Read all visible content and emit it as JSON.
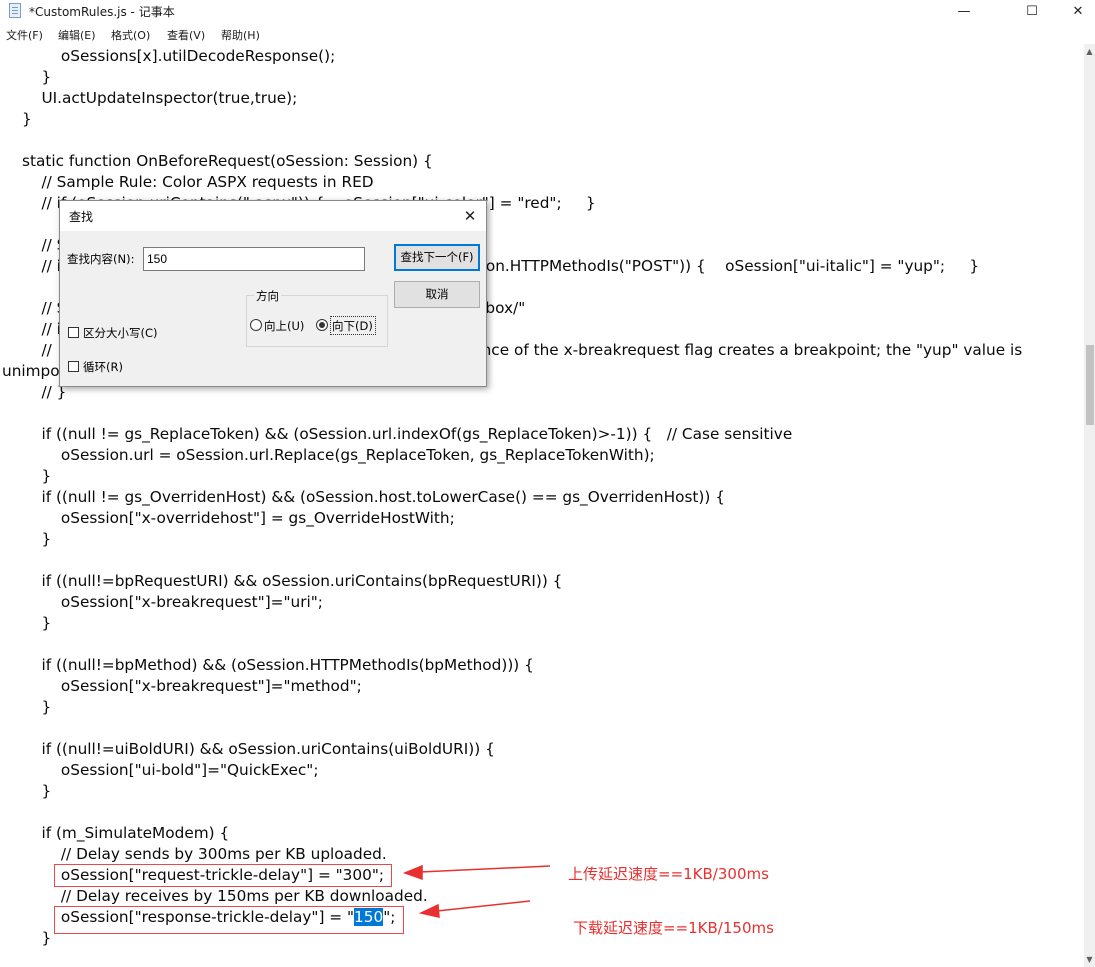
{
  "window": {
    "title": "*CustomRules.js - 记事本",
    "minimize_glyph": "—",
    "maximize_glyph": "☐",
    "close_glyph": "✕"
  },
  "menu": {
    "items": [
      "文件(F)",
      "编辑(E)",
      "格式(O)",
      "查看(V)",
      "帮助(H)"
    ]
  },
  "code": {
    "lines": [
      {
        "text": "        oSessions[x].utilDecodeResponse();"
      },
      {
        "text": "    }"
      },
      {
        "text": "    UI.actUpdateInspector(true,true);"
      },
      {
        "text": "}"
      },
      {
        "text": ""
      },
      {
        "text": "static function OnBeforeRequest(oSession: Session) {"
      },
      {
        "text": "    // Sample Rule: Color ASPX requests in RED"
      },
      {
        "text": "    // if (oSession.uriContains(\".aspx\")) {    oSession[\"ui-color\"] = \"red\";     }"
      },
      {
        "text": ""
      },
      {
        "text": "    // Sample Rule: Flag POSTs to fiddler2.com in italics"
      },
      {
        "text": "    // if (oSession.HostnameIs(\"www.fiddler2.com\") && oSession.HTTPMethodIs(\"POST\")) {    oSession[\"ui-italic\"] = \"yup\";     }"
      },
      {
        "text": ""
      },
      {
        "text": "    // Sample Rule: Break requests for URLs containing \"/sandbox/\""
      },
      {
        "text": "    // if (oSession.uriContains(\"/sandbox/\")) {"
      },
      {
        "text": "    //     oSession.oFlags[\"x-breakrequest\"] = \"yup\";  // Existence of the x-breakrequest flag creates a breakpoint; the \"yup\" value is"
      },
      {
        "text": "unimportant."
      },
      {
        "text": "    // }"
      },
      {
        "text": ""
      },
      {
        "text": "    if ((null != gs_ReplaceToken) && (oSession.url.indexOf(gs_ReplaceToken)>-1)) {   // Case sensitive"
      },
      {
        "text": "        oSession.url = oSession.url.Replace(gs_ReplaceToken, gs_ReplaceTokenWith);"
      },
      {
        "text": "    }"
      },
      {
        "text": "    if ((null != gs_OverridenHost) && (oSession.host.toLowerCase() == gs_OverridenHost)) {"
      },
      {
        "text": "        oSession[\"x-overridehost\"] = gs_OverrideHostWith;"
      },
      {
        "text": "    }"
      },
      {
        "text": ""
      },
      {
        "text": "    if ((null!=bpRequestURI) && oSession.uriContains(bpRequestURI)) {"
      },
      {
        "text": "        oSession[\"x-breakrequest\"]=\"uri\";"
      },
      {
        "text": "    }"
      },
      {
        "text": ""
      },
      {
        "text": "    if ((null!=bpMethod) && (oSession.HTTPMethodIs(bpMethod))) {"
      },
      {
        "text": "        oSession[\"x-breakrequest\"]=\"method\";"
      },
      {
        "text": "    }"
      },
      {
        "text": ""
      },
      {
        "text": "    if ((null!=uiBoldURI) && oSession.uriContains(uiBoldURI)) {"
      },
      {
        "text": "        oSession[\"ui-bold\"]=\"QuickExec\";"
      },
      {
        "text": "    }"
      },
      {
        "text": ""
      },
      {
        "text": "    if (m_SimulateModem) {"
      },
      {
        "text": "        // Delay sends by 300ms per KB uploaded."
      },
      {
        "text": "        oSession[\"request-trickle-delay\"] = \"300\";"
      },
      {
        "text": "        // Delay receives by 150ms per KB downloaded."
      },
      {
        "text": "        oSession[\"response-trickle-delay\"] = \"",
        "highlight": "150",
        "after": "\";"
      },
      {
        "text": "    }"
      }
    ]
  },
  "find_dialog": {
    "title": "查找",
    "find_label": "查找内容(N):",
    "find_value": "150",
    "find_next_button": "查找下一个(F)",
    "cancel_button": "取消",
    "direction_label": "方向",
    "up_label": "向上(U)",
    "down_label": "向下(D)",
    "direction_selected": "down",
    "match_case_label": "区分大小写(C)",
    "match_case_checked": false,
    "wrap_label": "循环(R)",
    "wrap_checked": false,
    "close_glyph": "✕"
  },
  "annotations": {
    "upload": "上传延迟速度==1KB/300ms",
    "download": "下载延迟速度==1KB/150ms",
    "color": "#e83030"
  },
  "scrollbar": {
    "up_glyph": "▲",
    "down_glyph": "▼"
  }
}
